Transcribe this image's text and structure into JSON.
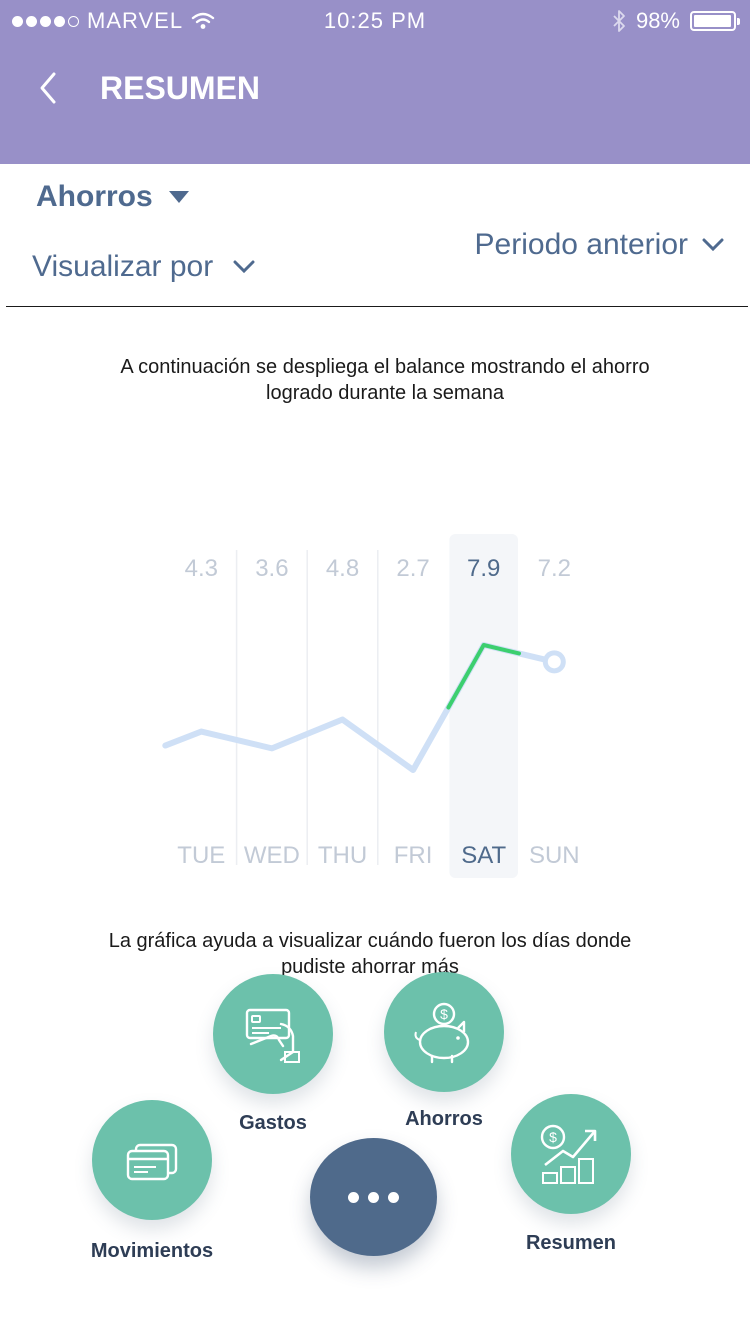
{
  "status_bar": {
    "carrier": "MARVEL",
    "time": "10:25 PM",
    "battery": "98%",
    "battery_level": 0.98
  },
  "header": {
    "title": "RESUMEN"
  },
  "filters": {
    "primary": "Ahorros",
    "secondary": "Visualizar por",
    "period": "Periodo anterior"
  },
  "intro_text": "A continuación se despliega el balance mostrando el ahorro logrado durante la semana",
  "chart_data": {
    "type": "line",
    "categories": [
      "TUE",
      "WED",
      "THU",
      "FRI",
      "SAT",
      "SUN"
    ],
    "value_labels": [
      "4.3",
      "3.6",
      "4.8",
      "2.7",
      "7.9",
      "7.2"
    ],
    "values": [
      4.3,
      3.6,
      4.8,
      2.7,
      7.9,
      7.2
    ],
    "selected": "SAT",
    "colors": {
      "line": "#cfe0f6",
      "highlight": "#3ccf6f",
      "selected_text": "#4f6a8b",
      "muted_text": "#c2cad6",
      "selected_band": "#f4f6f9"
    }
  },
  "outro_text": "La gráfica ayuda a visualizar cuándo fueron los días donde pudiste ahorrar más",
  "actions": {
    "movimientos": "Movimientos",
    "gastos": "Gastos",
    "ahorros": "Ahorros",
    "resumen": "Resumen"
  },
  "colors": {
    "header": "#9890c8",
    "accent": "#6cc1ab",
    "fab": "#4f6a8b",
    "text_primary": "#4f6a8f"
  }
}
